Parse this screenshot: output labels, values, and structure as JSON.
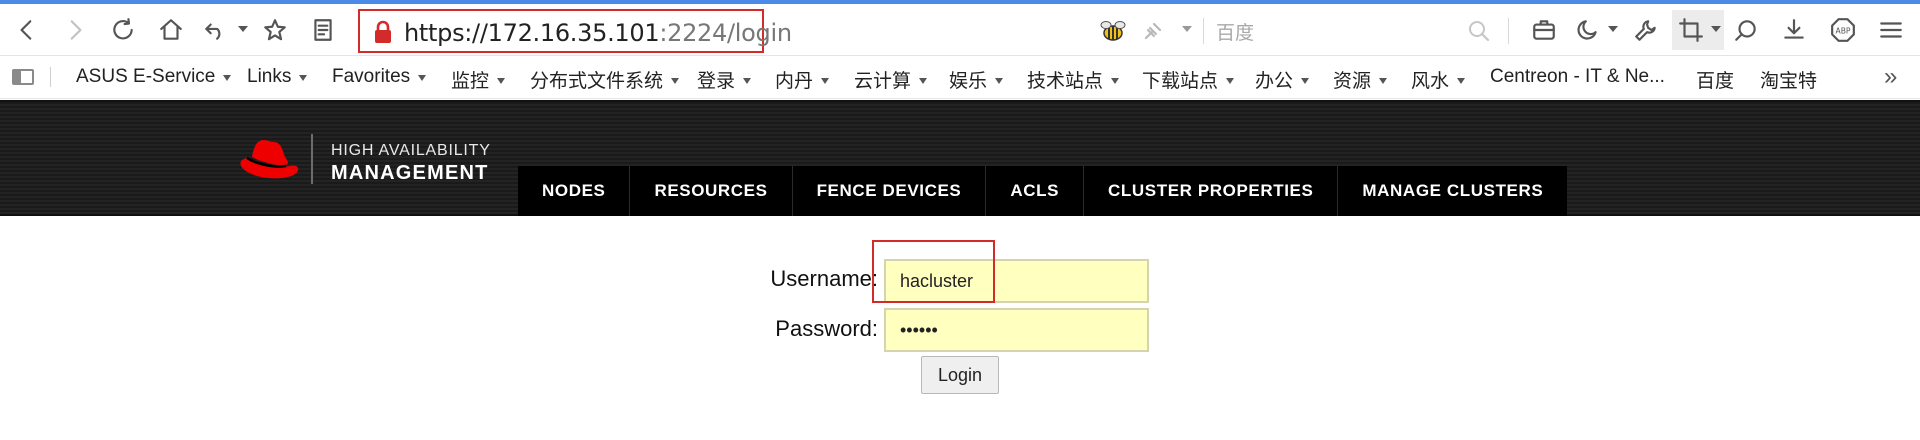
{
  "browser": {
    "url_main": "https://172.16.35.101",
    "url_port_path": ":2224/login",
    "search_placeholder": "百度",
    "accent_color": "#4a8be8",
    "highlight_color": "#d42a2a",
    "toolbar_icons": [
      "back-icon",
      "forward-icon",
      "reload-icon",
      "home-icon",
      "undo-icon",
      "star-icon",
      "reader-icon",
      "lock-icon",
      "bee-icon",
      "plug-icon",
      "search-icon",
      "briefcase-icon",
      "moon-icon",
      "wrench-icon",
      "crop-icon",
      "headset-icon",
      "download-icon",
      "adblock-icon",
      "menu-icon"
    ]
  },
  "bookmarks": [
    {
      "label": "ASUS E-Service",
      "dropdown": true
    },
    {
      "label": "Links",
      "dropdown": true
    },
    {
      "label": "Favorites",
      "dropdown": true
    },
    {
      "label": "监控",
      "dropdown": true
    },
    {
      "label": "分布式文件系统",
      "dropdown": true
    },
    {
      "label": "登录",
      "dropdown": true
    },
    {
      "label": "内丹",
      "dropdown": true
    },
    {
      "label": "云计算",
      "dropdown": true
    },
    {
      "label": "娱乐",
      "dropdown": true
    },
    {
      "label": "技术站点",
      "dropdown": true
    },
    {
      "label": "下载站点",
      "dropdown": true
    },
    {
      "label": "办公",
      "dropdown": true
    },
    {
      "label": "资源",
      "dropdown": true
    },
    {
      "label": "风水",
      "dropdown": true
    },
    {
      "label": "Centreon - IT & Ne...",
      "dropdown": false
    },
    {
      "label": "百度",
      "dropdown": false
    },
    {
      "label": "淘宝特",
      "dropdown": false
    }
  ],
  "bookmarks_overflow": "»",
  "app": {
    "logo_line1": "HIGH AVAILABILITY",
    "logo_line2": "MANAGEMENT",
    "brand_color": "#ee0000",
    "nav": [
      "NODES",
      "RESOURCES",
      "FENCE DEVICES",
      "ACLS",
      "CLUSTER PROPERTIES",
      "MANAGE CLUSTERS"
    ]
  },
  "login": {
    "username_label": "Username:",
    "username_value": "hacluster",
    "password_label": "Password:",
    "password_value": "••••••",
    "button_label": "Login"
  }
}
